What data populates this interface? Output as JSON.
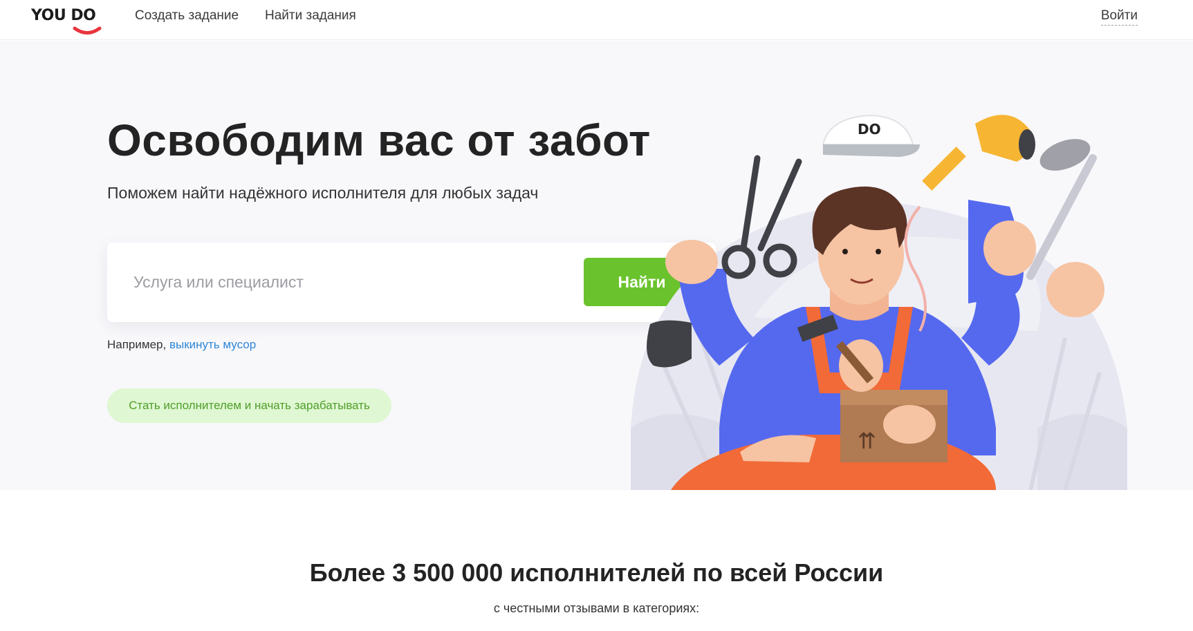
{
  "header": {
    "logo_text": "YOU DO",
    "nav": {
      "create_task": "Создать задание",
      "find_tasks": "Найти задания"
    },
    "login": "Войти"
  },
  "hero": {
    "title": "Освободим вас от забот",
    "subtitle": "Поможем найти надёжного исполнителя для любых задач",
    "search": {
      "placeholder": "Услуга или специалист",
      "value": "",
      "button": "Найти"
    },
    "example_prefix": "Например,",
    "example_link": "выкинуть мусор",
    "become_performer": "Стать исполнителем и начать зарабатывать",
    "cap_text": "DO"
  },
  "stats": {
    "title": "Более 3 500 000 исполнителей по всей России",
    "subtitle": "с честными отзывами в категориях:"
  },
  "colors": {
    "accent_green": "#6ac32d",
    "link_blue": "#2f86d6",
    "hero_bg": "#f8f8fb",
    "logo_red": "#e8343d"
  }
}
